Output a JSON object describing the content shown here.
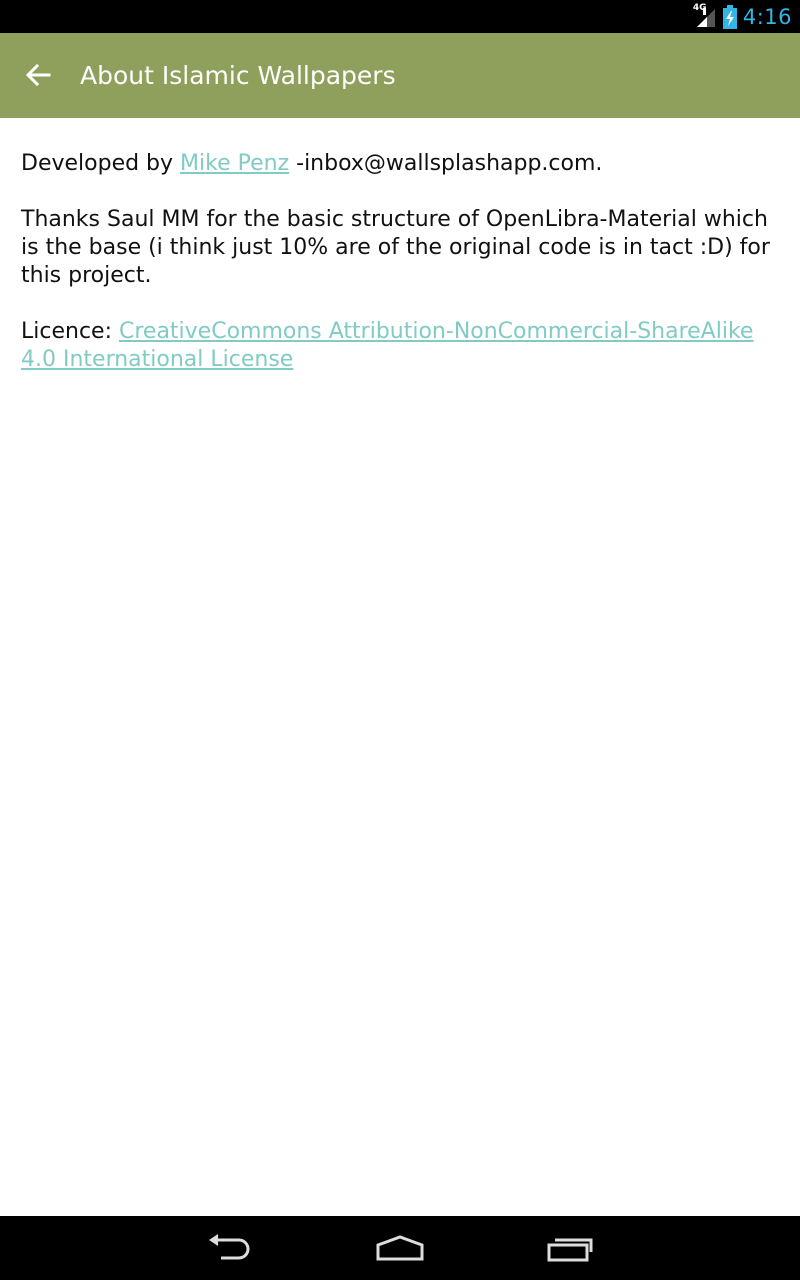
{
  "status_bar": {
    "network_label": "4G",
    "time": "4:16",
    "icons": [
      "signal-icon",
      "battery-charging-icon"
    ]
  },
  "app_bar": {
    "title": "About Islamic Wallpapers",
    "back_icon": "back-arrow-icon",
    "color": "#8fa05c"
  },
  "content": {
    "developer": {
      "prefix": "Developed by ",
      "link_text": "Mike Penz",
      "suffix": " -inbox@wallsplashapp.com."
    },
    "thanks": "Thanks Saul MM for the basic structure of OpenLibra-Material which is the base (i think just 10% are of the original code is in tact :D) for this project.",
    "licence": {
      "prefix": "Licence: ",
      "link_text": "CreativeCommons Attribution-NonCommercial-ShareAlike 4.0 International License"
    },
    "link_color": "#80cbc4"
  },
  "nav_bar": {
    "buttons": [
      "back-nav-icon",
      "home-nav-icon",
      "recents-nav-icon"
    ]
  }
}
